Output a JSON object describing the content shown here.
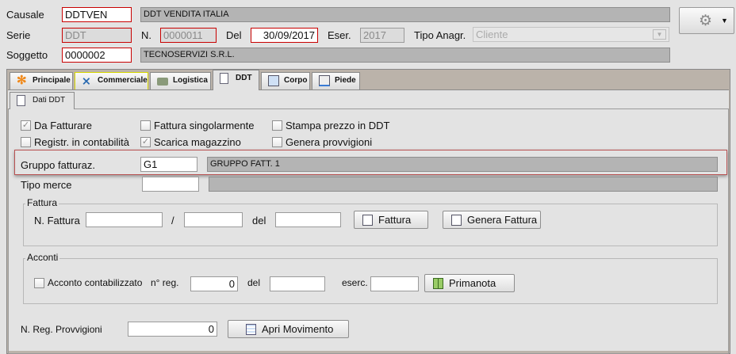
{
  "header": {
    "causale_label": "Causale",
    "causale_value": "DDTVEN",
    "causale_desc": "DDT VENDITA ITALIA",
    "serie_label": "Serie",
    "serie_value": "DDT",
    "numero_label": "N.",
    "numero_value": "0000011",
    "del_label": "Del",
    "del_value": "30/09/2017",
    "eser_label": "Eser.",
    "eser_value": "2017",
    "tipo_anagr_label": "Tipo Anagr.",
    "tipo_anagr_value": "Cliente",
    "soggetto_label": "Soggetto",
    "soggetto_value": "0000002",
    "soggetto_desc": "TECNOSERVIZI S.R.L.",
    "gear_icon": "gear-icon"
  },
  "tabs": [
    {
      "label": "Principale",
      "icon": "gear-orange-icon"
    },
    {
      "label": "Commerciale",
      "icon": "network-icon"
    },
    {
      "label": "Logistica",
      "icon": "truck-icon"
    },
    {
      "label": "DDT",
      "icon": "document-icon",
      "selected": true
    },
    {
      "label": "Corpo",
      "icon": "window-icon"
    },
    {
      "label": "Piede",
      "icon": "footer-icon"
    }
  ],
  "subtab": {
    "label": "Dati DDT"
  },
  "checkboxes": [
    {
      "label": "Da Fatturare",
      "checked": true
    },
    {
      "label": "Fattura singolarmente",
      "checked": false
    },
    {
      "label": "Stampa prezzo in DDT",
      "checked": false
    },
    {
      "label": "Registr. in contabilità",
      "checked": false
    },
    {
      "label": "Scarica magazzino",
      "checked": true
    },
    {
      "label": "Genera provvigioni",
      "checked": false
    }
  ],
  "gruppo": {
    "label": "Gruppo fatturaz.",
    "value": "G1",
    "desc": "GRUPPO FATT. 1"
  },
  "tipo_merce": {
    "label": "Tipo merce",
    "value": "",
    "desc": ""
  },
  "fattura": {
    "legend": "Fattura",
    "n_label": "N. Fattura",
    "sep": "/",
    "del_label": "del",
    "btn_fattura": "Fattura",
    "btn_genera": "Genera Fattura"
  },
  "acconti": {
    "legend": "Acconti",
    "checkbox_label": "Acconto contabilizzato",
    "checked": false,
    "nreg_label": "n° reg.",
    "nreg_value": "0",
    "del_label": "del",
    "eserc_label": "eserc.",
    "btn_primanota": "Primanota"
  },
  "provvigioni": {
    "label": "N. Reg. Provvigioni",
    "value": "0",
    "btn": "Apri Movimento"
  },
  "colors": {
    "required_border": "#c80000",
    "tab_strip": "#bbb3aa",
    "highlight": "#c80000"
  }
}
